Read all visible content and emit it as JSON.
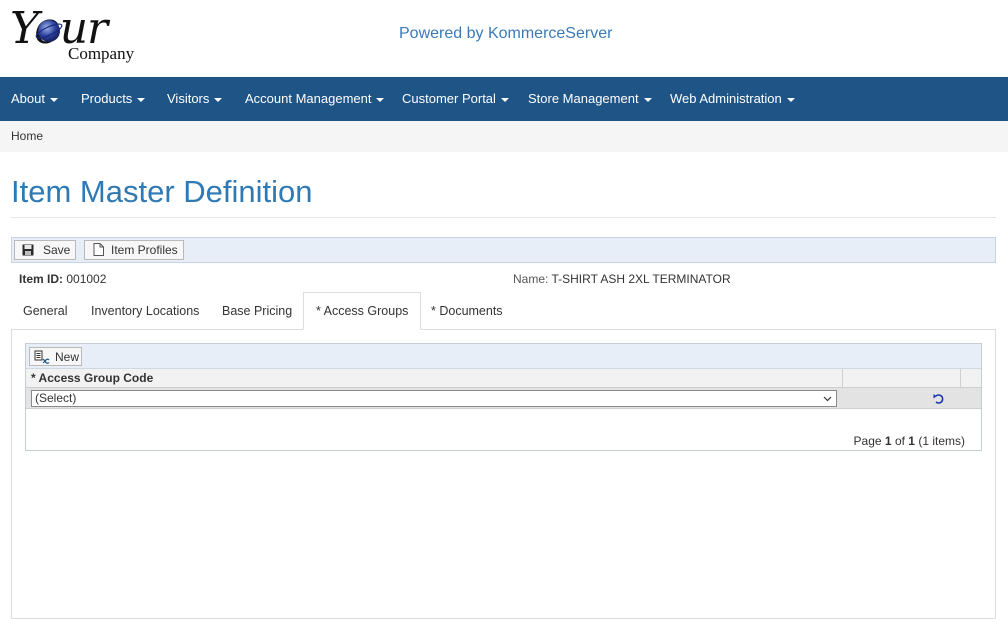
{
  "header": {
    "logo_your": "Your",
    "logo_company": "Company",
    "powered_by": "Powered by KommerceServer"
  },
  "nav": {
    "items": [
      {
        "label": "About"
      },
      {
        "label": "Products"
      },
      {
        "label": "Visitors"
      },
      {
        "label": "Account Management"
      },
      {
        "label": "Customer Portal"
      },
      {
        "label": "Store Management"
      },
      {
        "label": "Web Administration"
      }
    ]
  },
  "breadcrumb": {
    "home": "Home"
  },
  "page": {
    "title": "Item Master Definition"
  },
  "toolbar": {
    "save_label": "Save",
    "item_profiles_label": "Item Profiles"
  },
  "item": {
    "id_label": "Item ID:",
    "id_value": "001002",
    "name_label": "Name:",
    "name_value": "T-SHIRT ASH 2XL TERMINATOR"
  },
  "tabs": [
    {
      "label": "General"
    },
    {
      "label": "Inventory Locations"
    },
    {
      "label": "Base Pricing"
    },
    {
      "label": "* Access Groups",
      "active": true
    },
    {
      "label": "* Documents"
    }
  ],
  "grid": {
    "new_label": "New",
    "columns": [
      "* Access Group Code"
    ],
    "rows": [
      {
        "access_group_code": "(Select)"
      }
    ],
    "pager": {
      "prefix": "Page",
      "current": "1",
      "of": "of",
      "total": "1",
      "items": "(1 items)"
    }
  },
  "colors": {
    "nav_background": "#1e5486",
    "title": "#2f7ab5",
    "powered_by": "#3a7ab8"
  },
  "icons": {
    "save": "floppy-disk-icon",
    "item_profiles": "document-icon",
    "new": "new-row-icon",
    "undo": "undo-icon",
    "dropdown": "chevron-down-icon",
    "logo_globe": "globe-icon"
  }
}
